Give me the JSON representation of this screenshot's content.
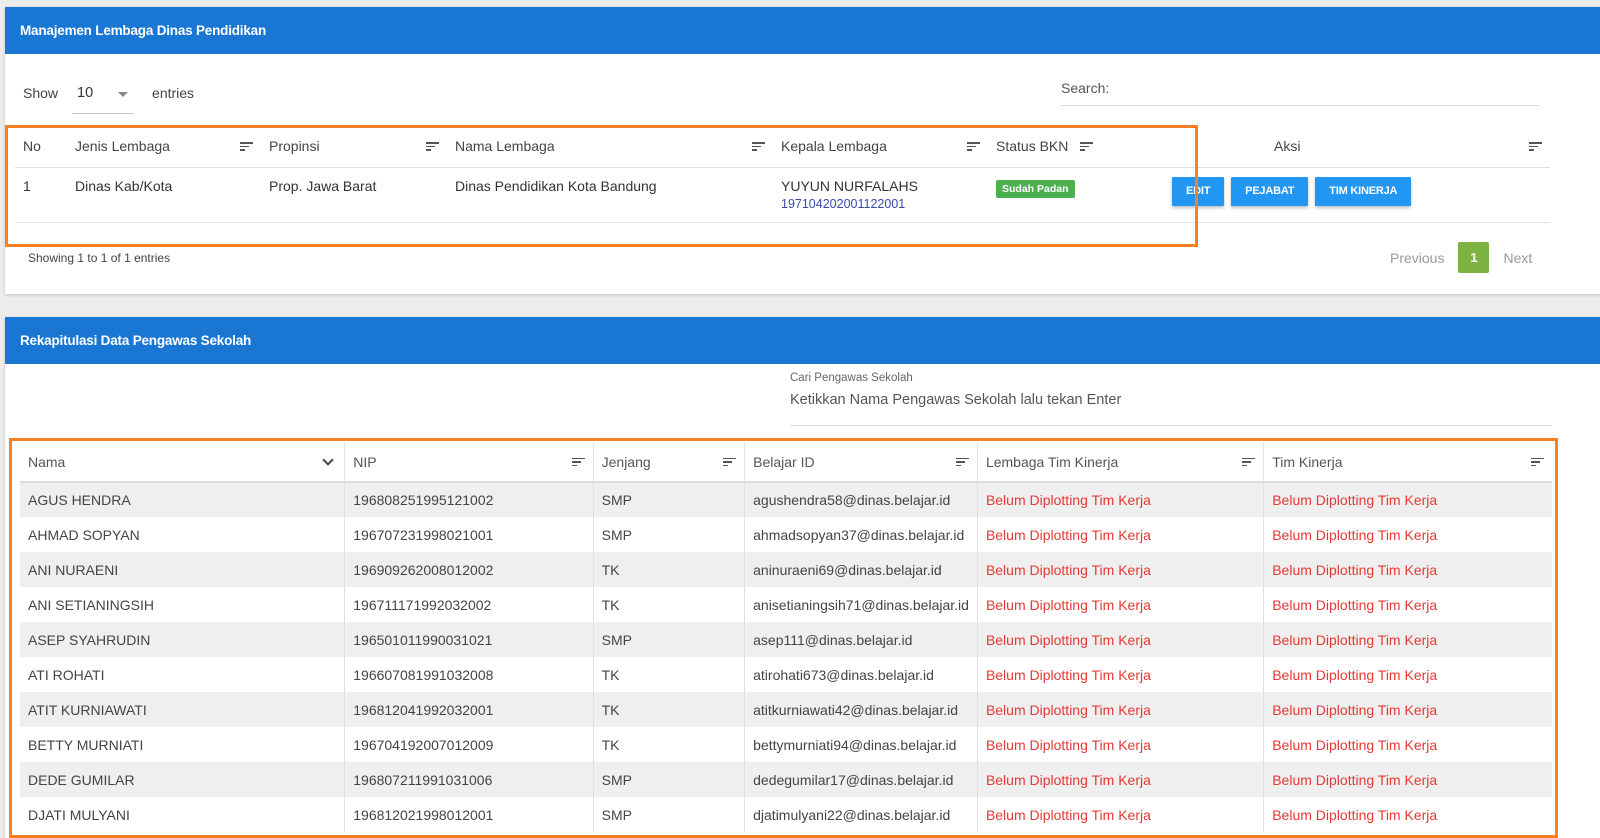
{
  "lembaga": {
    "title": "Manajemen Lembaga Dinas Pendidikan",
    "show_label": "Show",
    "entries_value": "10",
    "entries_label": "entries",
    "search_label": "Search:",
    "columns": [
      "No",
      "Jenis Lembaga",
      "Propinsi",
      "Nama Lembaga",
      "Kepala Lembaga",
      "Status BKN",
      "Aksi"
    ],
    "row": {
      "no": "1",
      "jenis": "Dinas Kab/Kota",
      "propinsi": "Prop. Jawa Barat",
      "nama": "Dinas Pendidikan Kota Bandung",
      "kepala_nama": "YUYUN NURFALAHS",
      "kepala_nip": "197104202001122001",
      "status": "Sudah Padan"
    },
    "buttons": {
      "edit": "EDIT",
      "pejabat": "PEJABAT",
      "tim": "TIM KINERJA"
    },
    "info": "Showing 1 to 1 of 1 entries",
    "pager": {
      "prev": "Previous",
      "page": "1",
      "next": "Next"
    },
    "colors": {
      "header": "#1976d2",
      "badge": "#4caf50",
      "button": "#2196f3",
      "page": "#7cb342"
    }
  },
  "pengawas": {
    "title": "Rekapitulasi Data Pengawas Sekolah",
    "cari_label": "Cari Pengawas Sekolah",
    "cari_placeholder": "Ketikkan Nama Pengawas Sekolah lalu tekan Enter",
    "columns": [
      "Nama",
      "NIP",
      "Jenjang",
      "Belajar ID",
      "Lembaga Tim Kinerja",
      "Tim Kinerja"
    ],
    "rows": [
      [
        "AGUS HENDRA",
        "196808251995121002",
        "SMP",
        "agushendra58@dinas.belajar.id",
        "Belum Diplotting Tim Kerja",
        "Belum Diplotting Tim Kerja"
      ],
      [
        "AHMAD SOPYAN",
        "196707231998021001",
        "SMP",
        "ahmadsopyan37@dinas.belajar.id",
        "Belum Diplotting Tim Kerja",
        "Belum Diplotting Tim Kerja"
      ],
      [
        "ANI NURAENI",
        "196909262008012002",
        "TK",
        "aninuraeni69@dinas.belajar.id",
        "Belum Diplotting Tim Kerja",
        "Belum Diplotting Tim Kerja"
      ],
      [
        "ANI SETIANINGSIH",
        "196711171992032002",
        "TK",
        "anisetianingsih71@dinas.belajar.id",
        "Belum Diplotting Tim Kerja",
        "Belum Diplotting Tim Kerja"
      ],
      [
        "ASEP SYAHRUDIN",
        "196501011990031021",
        "SMP",
        "asep111@dinas.belajar.id",
        "Belum Diplotting Tim Kerja",
        "Belum Diplotting Tim Kerja"
      ],
      [
        "ATI ROHATI",
        "196607081991032008",
        "TK",
        "atirohati673@dinas.belajar.id",
        "Belum Diplotting Tim Kerja",
        "Belum Diplotting Tim Kerja"
      ],
      [
        "ATIT KURNIAWATI",
        "196812041992032001",
        "TK",
        "atitkurniawati42@dinas.belajar.id",
        "Belum Diplotting Tim Kerja",
        "Belum Diplotting Tim Kerja"
      ],
      [
        "BETTY MURNIATI",
        "196704192007012009",
        "TK",
        "bettymurniati94@dinas.belajar.id",
        "Belum Diplotting Tim Kerja",
        "Belum Diplotting Tim Kerja"
      ],
      [
        "DEDE GUMILAR",
        "196807211991031006",
        "SMP",
        "dedegumilar17@dinas.belajar.id",
        "Belum Diplotting Tim Kerja",
        "Belum Diplotting Tim Kerja"
      ],
      [
        "DJATI MULYANI",
        "196812021998012001",
        "SMP",
        "djatimulyani22@dinas.belajar.id",
        "Belum Diplotting Tim Kerja",
        "Belum Diplotting Tim Kerja"
      ]
    ],
    "colors": {
      "status_text": "#e53935",
      "highlight": "#f58025"
    }
  }
}
